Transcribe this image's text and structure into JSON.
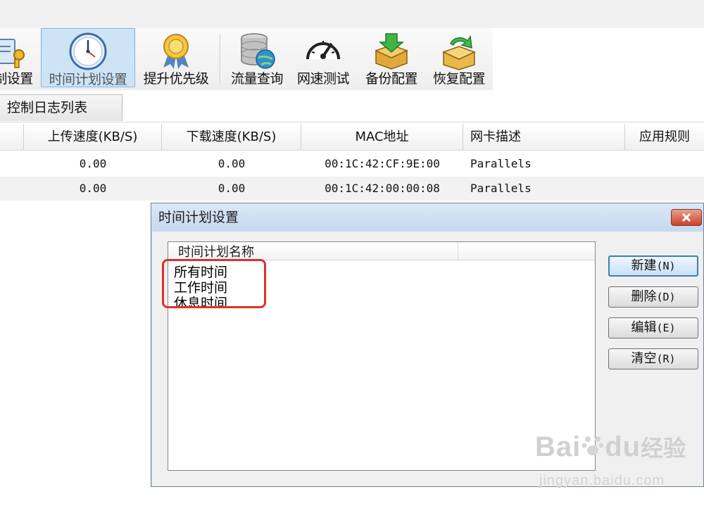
{
  "toolbar": {
    "items": [
      {
        "label": "制设置",
        "icon": "control-settings-icon"
      },
      {
        "label": "时间计划设置",
        "icon": "clock-icon",
        "active": true
      },
      {
        "label": "提升优先级",
        "icon": "award-ribbon-icon"
      },
      {
        "label": "流量查询",
        "icon": "database-globe-icon"
      },
      {
        "label": "网速测试",
        "icon": "speedometer-icon"
      },
      {
        "label": "备份配置",
        "icon": "box-download-icon"
      },
      {
        "label": "恢复配置",
        "icon": "box-restore-icon"
      }
    ]
  },
  "tabs": {
    "log_list": "控制日志列表"
  },
  "grid": {
    "columns": [
      "上传速度(KB/S)",
      "下载速度(KB/S)",
      "MAC地址",
      "网卡描述",
      "应用规则"
    ],
    "rows": [
      {
        "upload": "0.00",
        "download": "0.00",
        "mac": "00:1C:42:CF:9E:00",
        "desc": "Parallels"
      },
      {
        "upload": "0.00",
        "download": "0.00",
        "mac": "00:1C:42:00:00:08",
        "desc": "Parallels"
      }
    ]
  },
  "dialog": {
    "title": "时间计划设置",
    "list_header": "时间计划名称",
    "items": [
      "所有时间",
      "工作时间",
      "休息时间"
    ],
    "buttons": {
      "new": "新建",
      "new_acc": "(N)",
      "delete": "删除",
      "delete_acc": "(D)",
      "edit": "编辑",
      "edit_acc": "(E)",
      "clear": "清空",
      "clear_acc": "(R)"
    }
  },
  "watermark": {
    "brand": "Bai",
    "brand2": "du",
    "cn": "经验",
    "url": "jingyan.baidu.com"
  },
  "colors": {
    "highlight": "#d9342b",
    "active_tab_bg": "#cde4f7",
    "title_bar": "#c6d9ef"
  }
}
